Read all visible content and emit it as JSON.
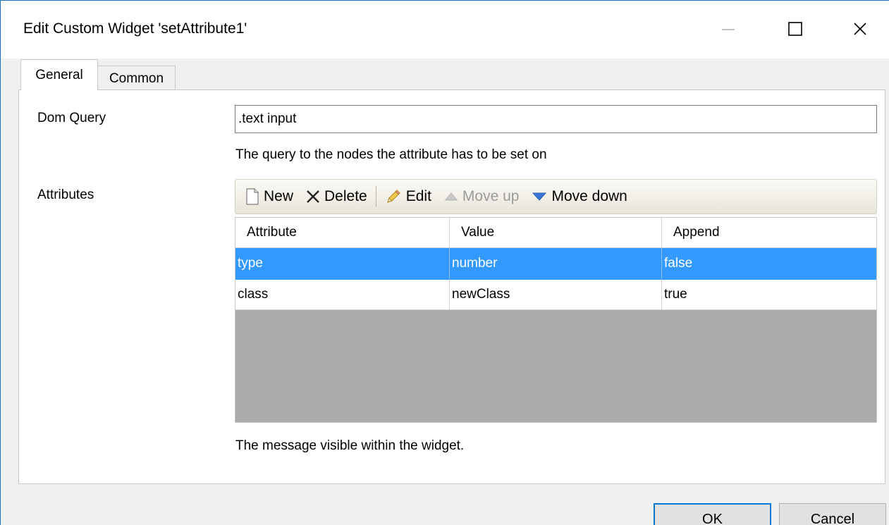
{
  "window": {
    "title": "Edit Custom Widget 'setAttribute1'",
    "min_icon": "minimize-icon",
    "max_icon": "maximize-icon",
    "close_icon": "close-icon"
  },
  "tabs": [
    {
      "label": "General",
      "active": true
    },
    {
      "label": "Common",
      "active": false
    }
  ],
  "dom_query": {
    "label": "Dom Query",
    "value": ".text input",
    "hint": "The query to the nodes the attribute has to be set on"
  },
  "attributes": {
    "label": "Attributes",
    "toolbar": {
      "new_label": "New",
      "delete_label": "Delete",
      "edit_label": "Edit",
      "move_up_label": "Move up",
      "move_down_label": "Move down"
    },
    "columns": [
      "Attribute",
      "Value",
      "Append"
    ],
    "rows": [
      {
        "attribute": "type",
        "value": "number",
        "append": "false",
        "selected": true
      },
      {
        "attribute": "class",
        "value": "newClass",
        "append": "true",
        "selected": false
      }
    ],
    "hint": "The message visible within the widget."
  },
  "buttons": {
    "ok_label": "OK",
    "cancel_label": "Cancel"
  },
  "colors": {
    "selection": "#3399ff",
    "accent": "#0078d7"
  }
}
